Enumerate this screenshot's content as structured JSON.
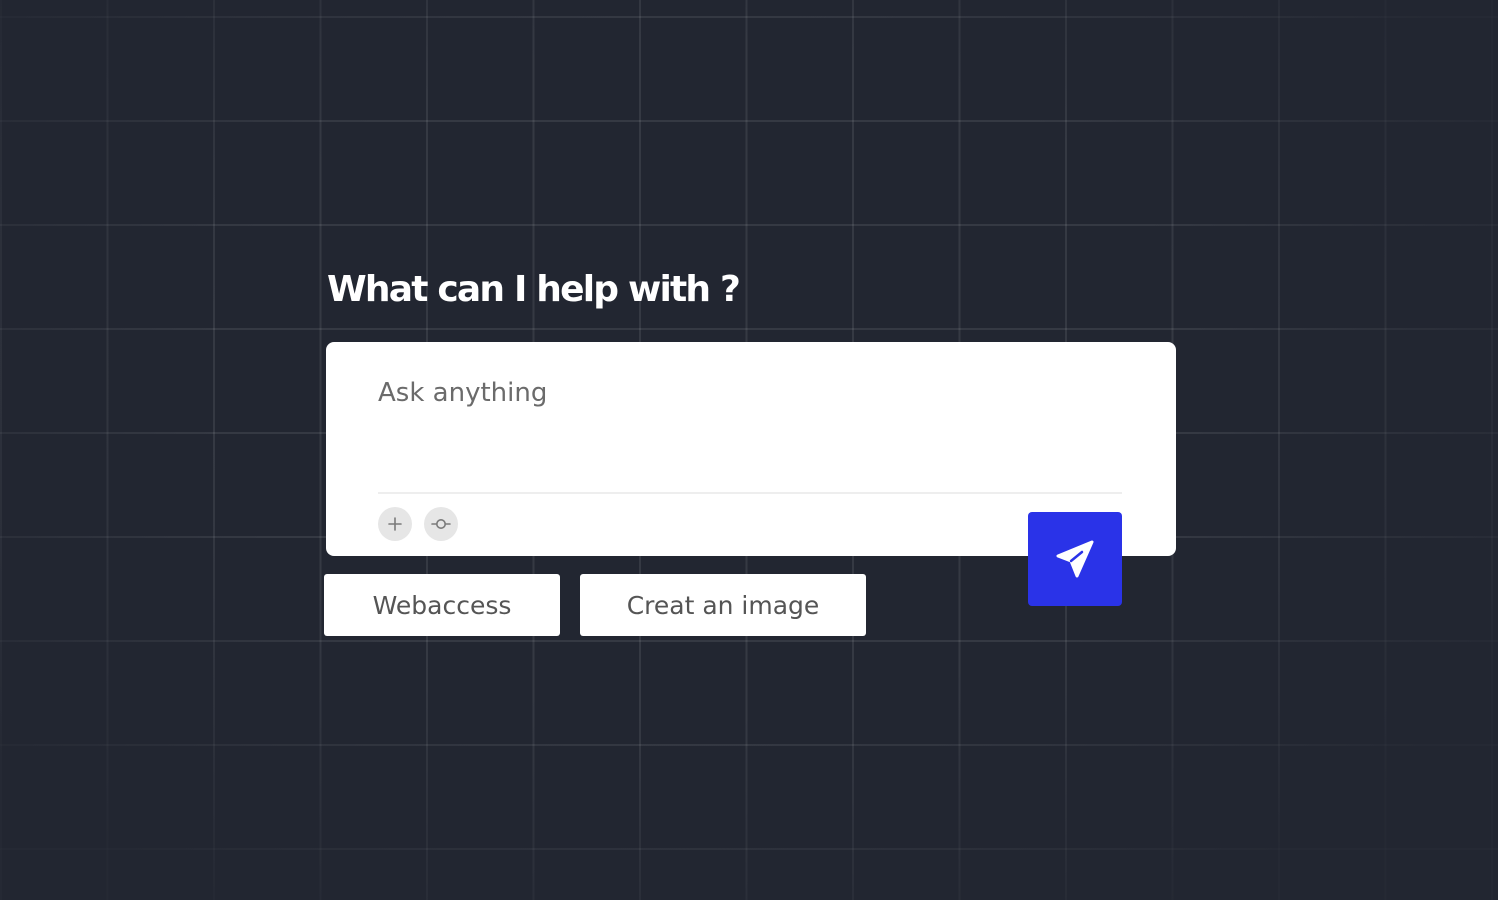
{
  "heading": "What can I help with ?",
  "prompt": {
    "placeholder": "Ask anything",
    "value": ""
  },
  "tools": [
    {
      "icon": "plus-icon"
    },
    {
      "icon": "commit-icon"
    }
  ],
  "send": {
    "icon": "paper-plane-icon",
    "color": "#2a33e8"
  },
  "suggestions": [
    {
      "label": "Webaccess"
    },
    {
      "label": "Creat an image"
    }
  ],
  "colors": {
    "background": "#222631",
    "card": "#ffffff",
    "accent": "#2a33e8"
  }
}
